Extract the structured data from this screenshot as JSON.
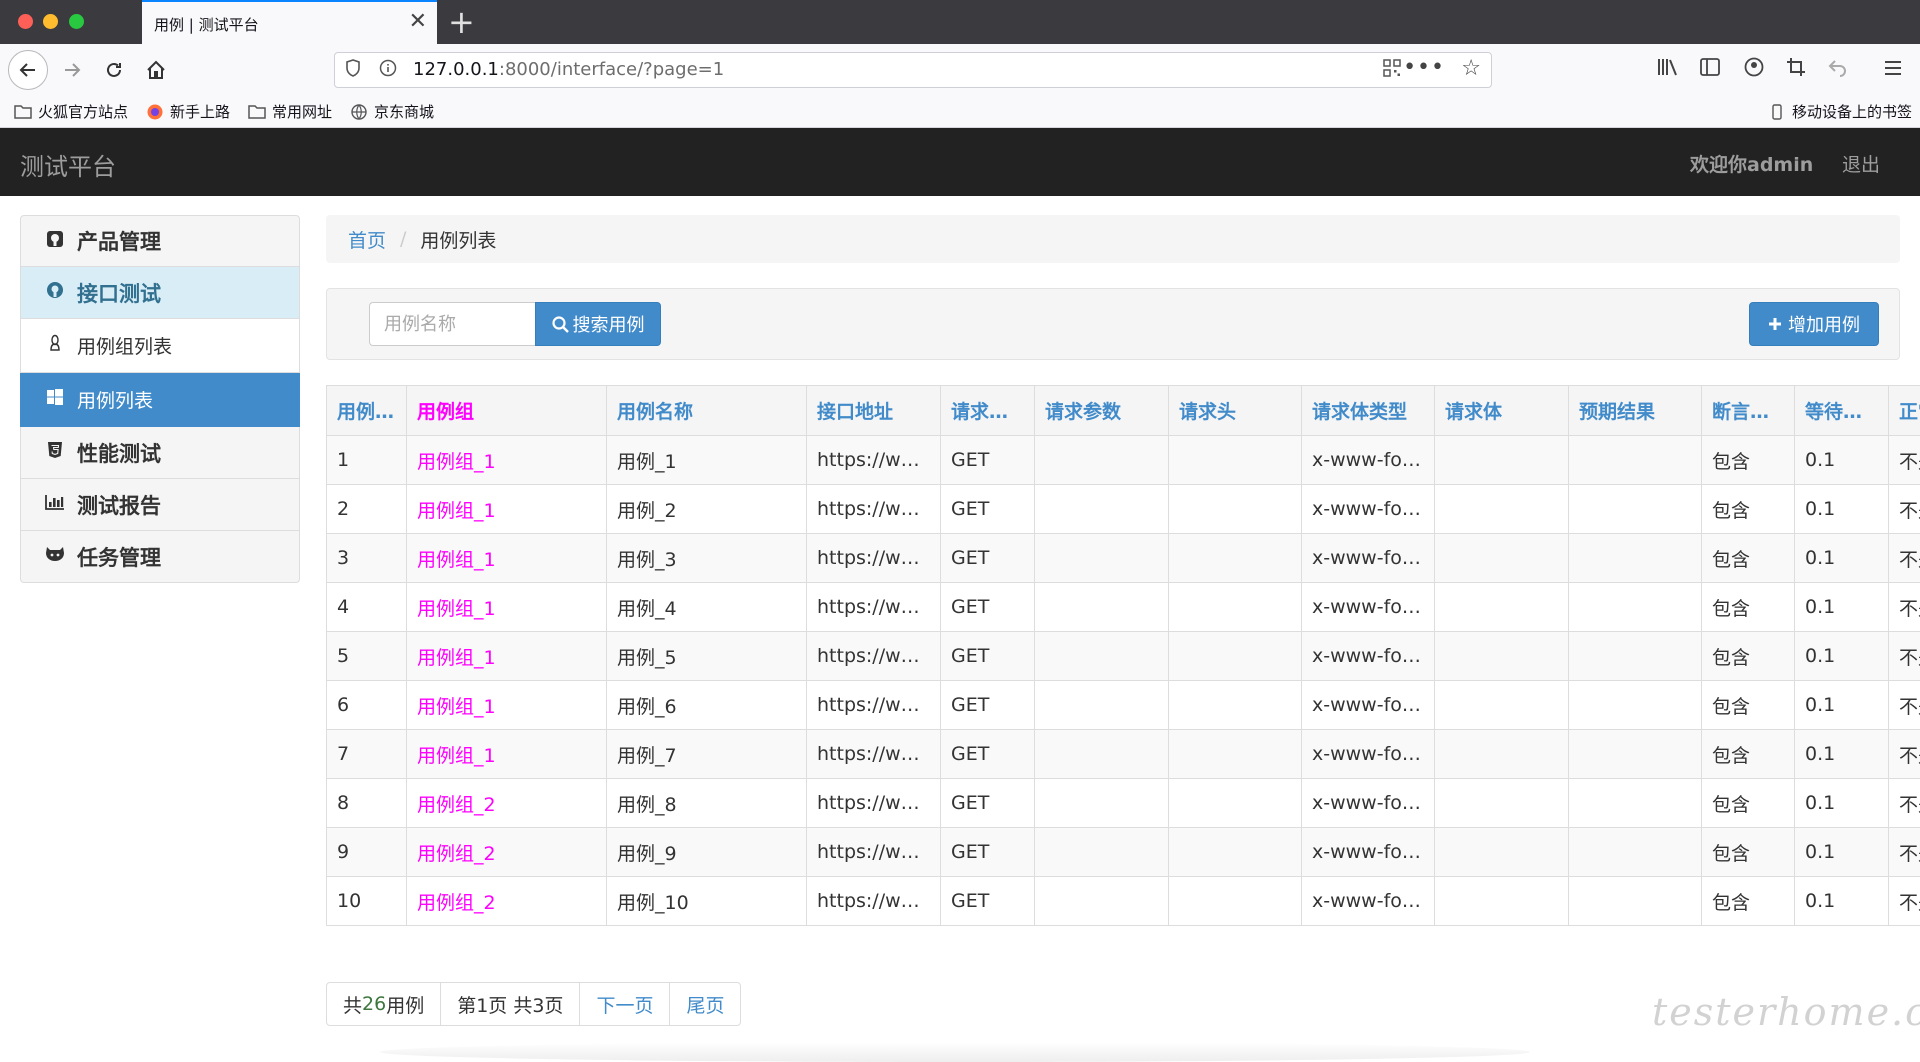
{
  "browser": {
    "tab_title": "用例 | 测试平台",
    "tab_close": "✕",
    "new_tab": "+",
    "url_host": "127.0.0.1",
    "url_path": ":8000/interface/?page=1",
    "bookmarks": [
      "火狐官方站点",
      "新手上路",
      "常用网址",
      "京东商城"
    ],
    "mobile_bookmarks": "移动设备上的书签"
  },
  "app": {
    "brand": "测试平台",
    "welcome": "欢迎你admin",
    "logout": "退出"
  },
  "sidebar": {
    "items": [
      {
        "label": "产品管理",
        "icon": "github-icon"
      },
      {
        "label": "接口测试",
        "icon": "github-alt-icon"
      },
      {
        "label": "用例组列表",
        "icon": "linux-icon"
      },
      {
        "label": "用例列表",
        "icon": "windows-icon"
      },
      {
        "label": "性能测试",
        "icon": "html5-icon"
      },
      {
        "label": "测试报告",
        "icon": "bar-chart-icon"
      },
      {
        "label": "任务管理",
        "icon": "octocat-icon"
      }
    ]
  },
  "breadcrumb": {
    "home": "首页",
    "separator": "/",
    "current": "用例列表"
  },
  "search": {
    "placeholder": "用例名称",
    "button": "搜索用例",
    "add_button": "增加用例"
  },
  "table": {
    "headers": [
      "用例ID",
      "用例组",
      "用例名称",
      "接口地址",
      "请求方式",
      "请求参数",
      "请求头",
      "请求体类型",
      "请求体",
      "预期结果",
      "断言方式",
      "等待时间",
      "正常"
    ],
    "rows": [
      [
        "1",
        "用例组_1",
        "用例_1",
        "https://ww…",
        "GET",
        "",
        "",
        "x-www-for…",
        "",
        "",
        "包含",
        "0.1",
        "不是"
      ],
      [
        "2",
        "用例组_1",
        "用例_2",
        "https://ww…",
        "GET",
        "",
        "",
        "x-www-for…",
        "",
        "",
        "包含",
        "0.1",
        "不是"
      ],
      [
        "3",
        "用例组_1",
        "用例_3",
        "https://ww…",
        "GET",
        "",
        "",
        "x-www-for…",
        "",
        "",
        "包含",
        "0.1",
        "不是"
      ],
      [
        "4",
        "用例组_1",
        "用例_4",
        "https://ww…",
        "GET",
        "",
        "",
        "x-www-for…",
        "",
        "",
        "包含",
        "0.1",
        "不是"
      ],
      [
        "5",
        "用例组_1",
        "用例_5",
        "https://ww…",
        "GET",
        "",
        "",
        "x-www-for…",
        "",
        "",
        "包含",
        "0.1",
        "不是"
      ],
      [
        "6",
        "用例组_1",
        "用例_6",
        "https://ww…",
        "GET",
        "",
        "",
        "x-www-for…",
        "",
        "",
        "包含",
        "0.1",
        "不是"
      ],
      [
        "7",
        "用例组_1",
        "用例_7",
        "https://ww…",
        "GET",
        "",
        "",
        "x-www-for…",
        "",
        "",
        "包含",
        "0.1",
        "不是"
      ],
      [
        "8",
        "用例组_2",
        "用例_8",
        "https://ww…",
        "GET",
        "",
        "",
        "x-www-for…",
        "",
        "",
        "包含",
        "0.1",
        "不是"
      ],
      [
        "9",
        "用例组_2",
        "用例_9",
        "https://ww…",
        "GET",
        "",
        "",
        "x-www-for…",
        "",
        "",
        "包含",
        "0.1",
        "不是"
      ],
      [
        "10",
        "用例组_2",
        "用例_10",
        "https://ww…",
        "GET",
        "",
        "",
        "x-www-for…",
        "",
        "",
        "包含",
        "0.1",
        "不是"
      ]
    ]
  },
  "pagination": {
    "total_prefix": "共",
    "total_count": "26",
    "total_suffix": "用例",
    "page_info": "第1页 共3页",
    "next": "下一页",
    "last": "尾页"
  },
  "watermark": "testerhome.com",
  "colors": {
    "primary": "#428bca",
    "group_link": "#ff00ff",
    "navbar": "#222222"
  }
}
